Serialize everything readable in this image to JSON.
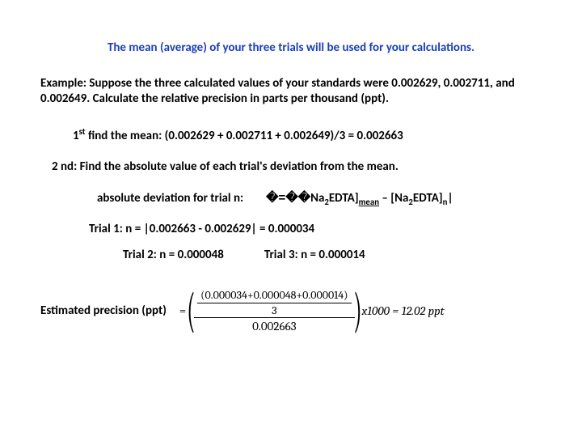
{
  "title": "The mean (average) of your three trials will be used for your calculations.",
  "example": "Example:  Suppose the three calculated values of your standards were 0.002629, 0.002711, and 0.002649.  Calculate the relative precision in parts per thousand (ppt).",
  "step1_prefix": "1",
  "step1_sup": "st",
  "step1_rest": " find the mean:  (0.002629  +  0.002711  +  0.002649)/3 =  0.002663",
  "step2": "2 nd:   Find the absolute value of each trial's deviation from the mean.",
  "abs_label": "absolute deviation for trial n:",
  "formula": {
    "lead": "�=��",
    "na2edta": "Na",
    "sub2": "2",
    "edta": "EDTA]",
    "mean": "mean",
    "minus": " – [Na",
    "edta2": "EDTA]",
    "n": "n",
    "endbar": "|"
  },
  "trial1": "Trial 1:   n = |0.002663  -  0.002629| =  0.000034",
  "trial2": "Trial 2:  n = 0.000048",
  "trial3": "Trial 3:  n = 0.000014",
  "est_label": "Estimated precision (ppt)",
  "frac": {
    "numtop": "(0.000034+0.000048+0.000014)",
    "numbot": "3",
    "den": "0.002663",
    "tail": "x1000 = 12.02 ppt"
  }
}
